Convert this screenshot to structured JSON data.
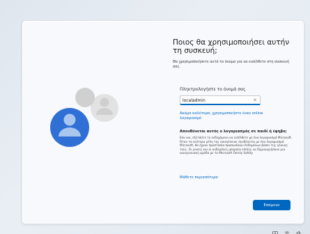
{
  "setup": {
    "title": "Ποιος θα χρησιμοποιήσει αυτήν τη συσκευή;",
    "subtitle": "Θα χρησιμοποιήσετε αυτό το όνομα για να εισέλθετε στη συσκευή σας.",
    "input_label": "Πληκτρολογήστε το όνομά σας",
    "input_value": "localadmin",
    "online_account_link": "Ακόμα καλύτερα, χρησιμοποιήστε έναν online λογαριασμό",
    "child_heading": "Απευθύνεται αυτός ο λογαριασμός σε παιδί ή έφηβο;",
    "child_body": "Εάν ναι, εξετάστε το ενδεχόμενο να εισέλθετε με ένα λογαριασμό Microsoft. Όταν τα νεότερα μέλη της οικογένειας συνδέονται με ένα λογαριασμό Microsoft, θα έχουν προστασία προσωπικών δεδομένων βάσει της ηλικίας τους. Οι γονείς και οι κηδεμόνες μπορούν επίσης να δημιουργήσουν μια οικογενειακή ομάδα με το Microsoft Family Safety.",
    "learn_more": "Μάθετε περισσότερα",
    "next_button": "Επόμενο"
  },
  "colors": {
    "accent": "#0067c0",
    "avatar_front": "#2f6fd6",
    "avatar_back": "#c4c4c4"
  },
  "tray_icons": [
    "accessibility-icon",
    "network-icon",
    "volume-icon"
  ]
}
